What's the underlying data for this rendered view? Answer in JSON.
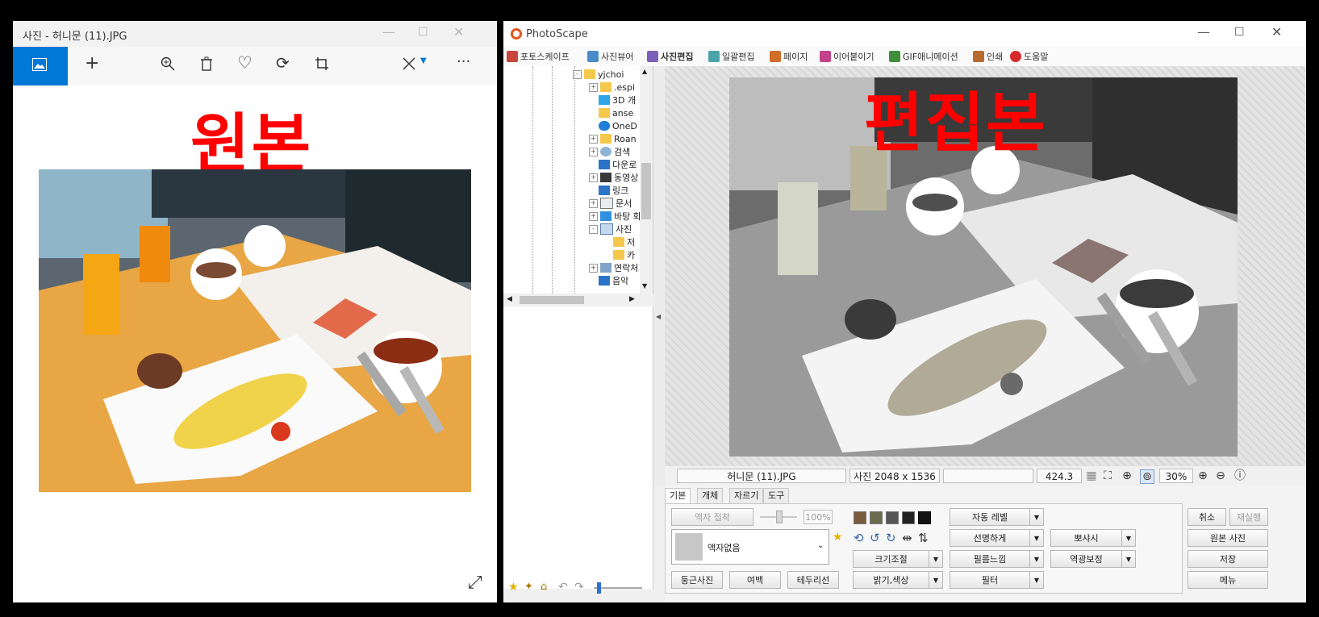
{
  "photos": {
    "title": "사진 - 허니문 (11).JPG",
    "overlay_text": "원본",
    "toolbar_icons": [
      "view-photo-icon",
      "add-icon",
      "zoom-in-icon",
      "delete-icon",
      "favorite-icon",
      "rotate-icon",
      "crop-icon",
      "edit-icon",
      "more-icon"
    ],
    "more_label": "···"
  },
  "photoscape": {
    "title": "PhotoScape",
    "menu": [
      {
        "label": "포토스케이프",
        "color": "#c9463d"
      },
      {
        "label": "사진뷰어",
        "color": "#4a8bc9"
      },
      {
        "label": "사진편집",
        "color": "#7b5fb8"
      },
      {
        "label": "일괄편집",
        "color": "#4aa3a8"
      },
      {
        "label": "페이지",
        "color": "#d26d2a"
      },
      {
        "label": "이어붙이기",
        "color": "#c2428a"
      },
      {
        "label": "GIF애니메이션",
        "color": "#3f8f3a"
      },
      {
        "label": "인쇄",
        "color": "#b86b2e"
      },
      {
        "label": "도움말",
        "color": "#d62b2b"
      }
    ],
    "active_menu": "사진편집",
    "tree": [
      {
        "label": "yjchoi",
        "type": "folder",
        "expand": "-"
      },
      {
        "label": ".espi",
        "type": "folder",
        "expand": "+"
      },
      {
        "label": "3D 개",
        "type": "3d",
        "expand": ""
      },
      {
        "label": "anse",
        "type": "folder",
        "expand": ""
      },
      {
        "label": "OneD",
        "type": "cloud",
        "expand": ""
      },
      {
        "label": "Roan",
        "type": "folder",
        "expand": "+"
      },
      {
        "label": "검색",
        "type": "search",
        "expand": "+"
      },
      {
        "label": "다운로",
        "type": "download",
        "expand": ""
      },
      {
        "label": "동영상",
        "type": "video",
        "expand": "+"
      },
      {
        "label": "링크",
        "type": "link",
        "expand": ""
      },
      {
        "label": "문서",
        "type": "doc",
        "expand": "+"
      },
      {
        "label": "바탕 화",
        "type": "desktop",
        "expand": "+"
      },
      {
        "label": "사진",
        "type": "pictures",
        "expand": "-"
      },
      {
        "label": "저",
        "type": "folder",
        "expand": ""
      },
      {
        "label": "카",
        "type": "folder",
        "expand": ""
      },
      {
        "label": "연락처",
        "type": "contacts",
        "expand": "+"
      },
      {
        "label": "음악",
        "type": "music",
        "expand": ""
      }
    ],
    "overlay_text": "편집본",
    "status": {
      "filename": "허니문 (11).JPG",
      "dimensions": "사진 2048 x 1536",
      "filesize": "424.3 KB",
      "zoom": "30%"
    },
    "tabs": [
      "기본",
      "개체",
      "자르기",
      "도구"
    ],
    "panel": {
      "frame_btn": "액자 접착",
      "frame_percent": "100%",
      "frame_select": "액자없음",
      "round_btn": "둥근사진",
      "margin_btn": "여백",
      "border_btn": "테두리선",
      "resize_btn": "크기조절",
      "brightness_btn": "밝기,색상",
      "auto_level_btn": "자동 레벨",
      "sharpen_btn": "선명하게",
      "film_btn": "필름느낌",
      "filter_btn": "필터",
      "bloom_btn": "뽀샤시",
      "backlight_btn": "역광보정",
      "cancel_btn": "취소",
      "redo_btn": "재실행",
      "original_btn": "원본 사진",
      "save_btn": "저장",
      "menu_btn": "메뉴"
    }
  }
}
